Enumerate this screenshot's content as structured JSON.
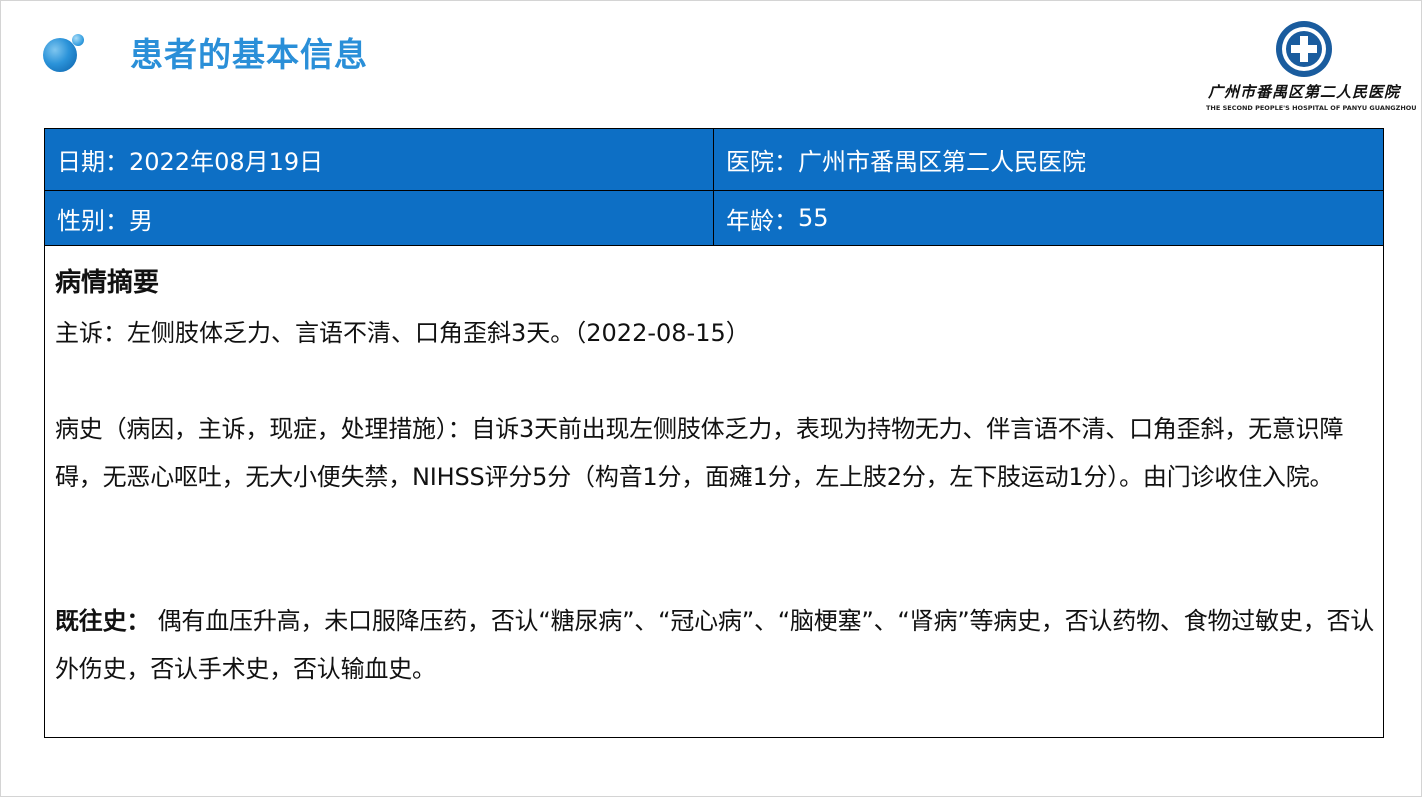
{
  "header": {
    "title": "患者的基本信息"
  },
  "logo": {
    "name_cn": "广州市番禺区第二人民医院",
    "name_en": "THE SECOND PEOPLE'S HOSPITAL OF PANYU GUANGZHOU"
  },
  "info": {
    "date_label": "日期：",
    "date_value": "2022年08月19日",
    "hospital_label": "医院：",
    "hospital_value": "广州市番禺区第二人民医院",
    "gender_label": "性别：",
    "gender_value": "男",
    "age_label": "年龄：",
    "age_value": "55"
  },
  "summary": {
    "title": "病情摘要",
    "complaint_label": "主诉：",
    "complaint_text": "左侧肢体乏力、言语不清、口角歪斜3天。（2022-08-15）",
    "history_label": "病史（病因，主诉，现症，处理措施）：",
    "history_text": "自诉3天前出现左侧肢体乏力，表现为持物无力、伴言语不清、口角歪斜，无意识障碍，无恶心呕吐，无大小便失禁，NIHSS评分5分（构音1分，面瘫1分，左上肢2分，左下肢运动1分）。由门诊收住入院。",
    "past_label": "既往史：",
    "past_text": " 偶有血压升高，未口服降压药，否认“糖尿病”、“冠心病”、“脑梗塞”、“肾病”等病史，否认药物、食物过敏史，否认外伤史，否认手术史，否认输血史。"
  },
  "colors": {
    "title_blue": "#2a8fd8",
    "table_blue": "#0d6fc5"
  }
}
